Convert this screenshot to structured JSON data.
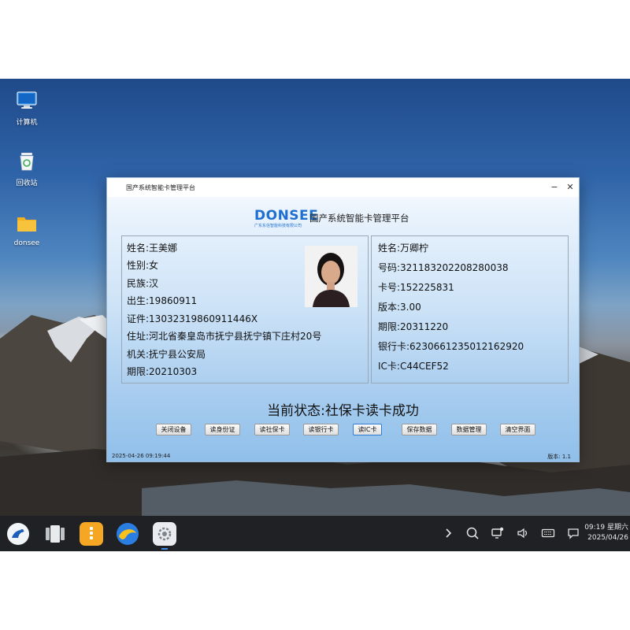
{
  "desktop": {
    "icons": [
      {
        "label": "计算机",
        "icon": "computer-icon"
      },
      {
        "label": "回收站",
        "icon": "recycle-bin-icon"
      },
      {
        "label": "donsee",
        "icon": "folder-icon"
      }
    ]
  },
  "window": {
    "title": "国产系统智能卡管理平台",
    "minimize": "−",
    "close": "✕",
    "logo_text": "DONSEE",
    "logo_sub": "广东东信智能科技有限公司",
    "platform_name": "国产系统智能卡管理平台",
    "id_card": {
      "name": "姓名:王美娜",
      "gender": "性别:女",
      "ethnicity": "民族:汉",
      "birth": "出生:19860911",
      "id_number": "证件:13032319860911446X",
      "address": "住址:河北省秦皇岛市抚宁县抚宁镇下庄村20号",
      "authority": "机关:抚宁县公安局",
      "validity": "期限:20210303"
    },
    "social_card": {
      "name": "姓名:万卿柠",
      "number": "号码:321183202208280038",
      "card_no": "卡号:152225831",
      "version": "版本:3.00",
      "validity": "期限:20311220",
      "bank_card": "银行卡:6230661235012162920",
      "ic_card": "IC卡:C44CEF52"
    },
    "status": "当前状态:社保卡读卡成功",
    "buttons": [
      "关闭设备",
      "读身份证",
      "读社保卡",
      "读银行卡",
      "读IC卡",
      "保存数据",
      "数据管理",
      "清空界面"
    ],
    "active_button": "读IC卡",
    "timestamp": "2025-04-26 09:19:44",
    "version_label": "版本: 1.1"
  },
  "taskbar": {
    "apps": [
      "launcher-icon",
      "multitask-icon",
      "notes-icon",
      "browser-icon",
      "settings-icon"
    ],
    "system": [
      "chevron-right-icon",
      "search-icon",
      "network-icon",
      "volume-icon",
      "keyboard-icon",
      "notification-icon"
    ],
    "time": "09:19 星期六",
    "date": "2025/04/26"
  },
  "colors": {
    "brand": "#1e6fd0",
    "taskbar": "#1f2124",
    "window_gradient_bottom": "#8fbfea"
  }
}
